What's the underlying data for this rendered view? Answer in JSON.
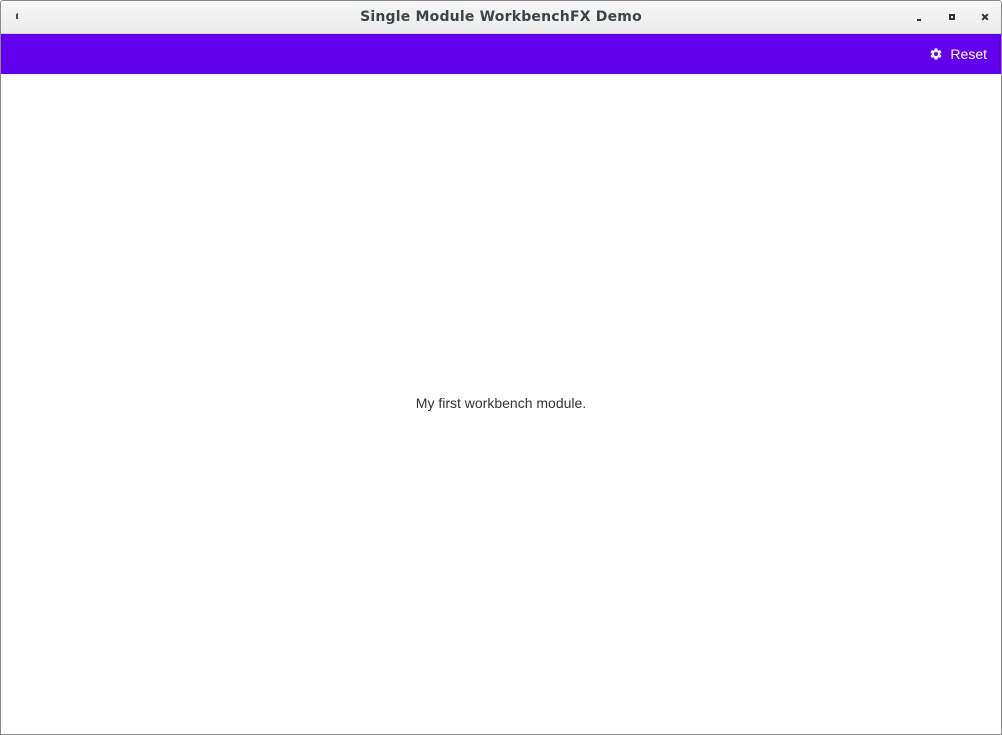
{
  "window": {
    "title": "Single Module WorkbenchFX Demo",
    "controls": [
      "minimize-icon",
      "maximize-icon",
      "close-icon"
    ]
  },
  "toolbar": {
    "background": "#6200ee",
    "reset_label": "Reset",
    "reset_icon": "gear-icon"
  },
  "module": {
    "text": "My first workbench module."
  }
}
